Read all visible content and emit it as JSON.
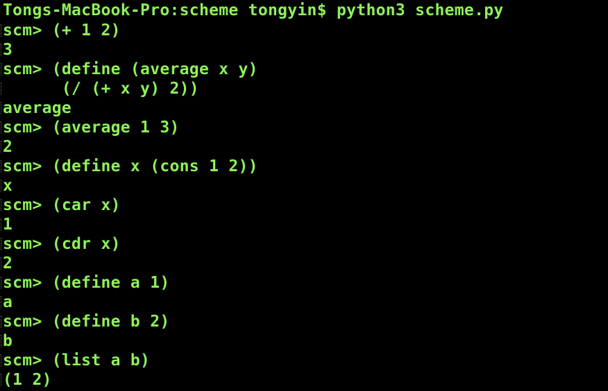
{
  "terminal": {
    "colors": {
      "background": "#000000",
      "text": "#8ef15a"
    },
    "lines": [
      "Tongs-MacBook-Pro:scheme tongyin$ python3 scheme.py",
      "scm> (+ 1 2)",
      "3",
      "scm> (define (average x y)",
      "      (/ (+ x y) 2))",
      "average",
      "scm> (average 1 3)",
      "2",
      "scm> (define x (cons 1 2))",
      "x",
      "scm> (car x)",
      "1",
      "scm> (cdr x)",
      "2",
      "scm> (define a 1)",
      "a",
      "scm> (define b 2)",
      "b",
      "scm> (list a b)",
      "(1 2)"
    ]
  }
}
